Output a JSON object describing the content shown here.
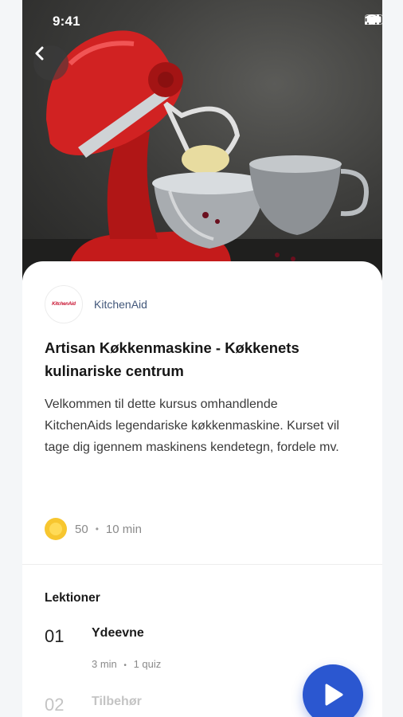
{
  "status_bar": {
    "time": "9:41"
  },
  "hero": {
    "alt": "KitchenAid Artisan stand mixer"
  },
  "course": {
    "brand_name": "KitchenAid",
    "brand_logo_text": "KitchenAid",
    "title": "Artisan Køkkenmaskine - Køkkenets kulinariske centrum",
    "description": "Velkommen til dette kursus omhandlende KitchenAids legendariske køkkenmaskine. Kurset vil tage dig igennem maskinens kendetegn, fordele mv.",
    "points": "50",
    "separator": "•",
    "duration": "10 min"
  },
  "lessons": {
    "heading": "Lektioner",
    "items": [
      {
        "number": "01",
        "title": "Ydeevne",
        "duration": "3 min",
        "separator": "•",
        "quiz": "1 quiz"
      },
      {
        "number": "02",
        "title": "Tilbehør"
      }
    ]
  },
  "icons": {
    "back": "chevron-left-icon",
    "play": "play-icon",
    "points": "coin-icon",
    "signal": "signal-icon",
    "wifi": "wifi-icon",
    "battery": "battery-icon"
  },
  "colors": {
    "accent": "#2b57d0",
    "brand_red": "#c8102e",
    "coin": "#f7c62f"
  }
}
